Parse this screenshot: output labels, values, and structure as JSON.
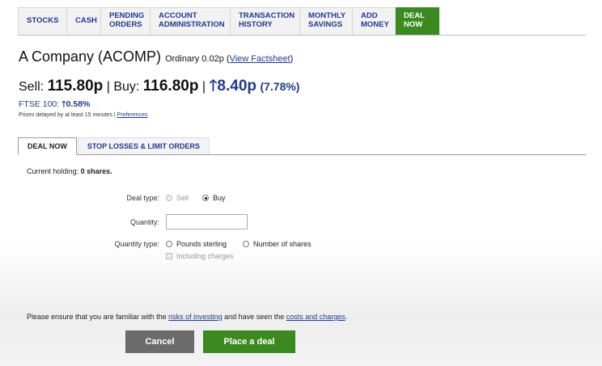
{
  "nav": {
    "tabs": [
      {
        "label": "STOCKS"
      },
      {
        "label": "CASH"
      },
      {
        "line1": "PENDING",
        "line2": "ORDERS"
      },
      {
        "line1": "ACCOUNT",
        "line2": "ADMINISTRATION"
      },
      {
        "line1": "TRANSACTION",
        "line2": "HISTORY"
      },
      {
        "line1": "MONTHLY",
        "line2": "SAVINGS"
      },
      {
        "line1": "ADD",
        "line2": "MONEY"
      },
      {
        "line1": "DEAL",
        "line2": "NOW"
      }
    ],
    "active": "DEAL NOW"
  },
  "stock": {
    "name": "A Company (ACOMP)",
    "share_class": "Ordinary 0.02p",
    "factsheet_link": "View Factsheet",
    "sell_label": "Sell:",
    "sell_price": "115.80p",
    "buy_label": "Buy:",
    "buy_price": "116.80p",
    "change_arrow": "🡑",
    "change": "8.40p",
    "change_pct": "(7.78%)"
  },
  "ftse": {
    "label": "FTSE 100:",
    "arrow": "🡑",
    "value": "0.58%"
  },
  "delay_notice": {
    "text": "Prices delayed by at least 15 minutes",
    "separator": "|",
    "preferences_link": "Preferences"
  },
  "subtabs": [
    {
      "label": "DEAL NOW"
    },
    {
      "label": "STOP LOSSES & LIMIT ORDERS"
    }
  ],
  "holding": {
    "label": "Current holding:",
    "value": "0 shares."
  },
  "form": {
    "deal_type_label": "Deal type:",
    "deal_type_options": [
      "Sell",
      "Buy"
    ],
    "deal_type_selected": "Buy",
    "quantity_label": "Quantity:",
    "quantity_value": "",
    "quantity_type_label": "Quantity type:",
    "quantity_type_options": [
      "Pounds sterling",
      "Number of shares"
    ],
    "including_charges_label": "Including charges"
  },
  "notice": {
    "prefix": "Please ensure that you are familiar with the",
    "risks_link": "risks of investing",
    "middle": "and have seen the",
    "costs_link": "costs and charges",
    "suffix": "."
  },
  "buttons": {
    "cancel": "Cancel",
    "place_deal": "Place a deal"
  },
  "colors": {
    "accent_green": "#3a8a1f",
    "link_blue": "#1f3a93",
    "cancel_grey": "#6b6b6b"
  }
}
